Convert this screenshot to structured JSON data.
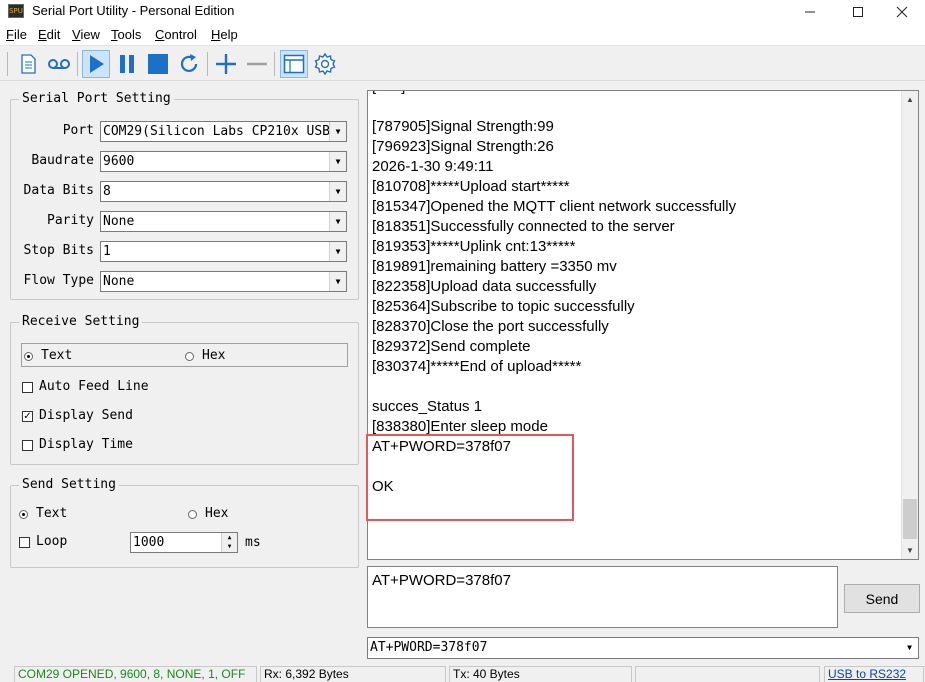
{
  "window": {
    "title": "Serial Port Utility - Personal Edition",
    "icon_label": "SPU",
    "minimize_icon": "minimize-icon",
    "maximize_icon": "maximize-icon",
    "close_icon": "close-icon"
  },
  "menu": [
    {
      "key": "F",
      "rest": "ile"
    },
    {
      "key": "E",
      "rest": "dit"
    },
    {
      "key": "V",
      "rest": "iew"
    },
    {
      "key": "T",
      "rest": "ools"
    },
    {
      "key": "C",
      "rest": "ontrol"
    },
    {
      "key": "H",
      "rest": "elp"
    }
  ],
  "toolbar": {
    "icons": [
      "new-file-icon",
      "record-icon",
      "play-icon",
      "pause-icon",
      "stop-icon",
      "refresh-icon",
      "add-icon",
      "remove-icon",
      "window-icon",
      "gear-icon"
    ],
    "accent": "#1e6fc8"
  },
  "serial_port_setting": {
    "title": "Serial Port Setting",
    "port_label": "Port",
    "port_value": "COM29(Silicon Labs CP210x USB",
    "baudrate_label": "Baudrate",
    "baudrate_value": "9600",
    "data_bits_label": "Data Bits",
    "data_bits_value": "8",
    "parity_label": "Parity",
    "parity_value": "None",
    "stop_bits_label": "Stop Bits",
    "stop_bits_value": "1",
    "flow_type_label": "Flow Type",
    "flow_type_value": "None"
  },
  "receive_setting": {
    "title": "Receive Setting",
    "text_label": "Text",
    "hex_label": "Hex",
    "mode": "Text",
    "auto_feed_line_label": "Auto Feed Line",
    "auto_feed_line_checked": false,
    "display_send_label": "Display Send",
    "display_send_checked": true,
    "display_time_label": "Display Time",
    "display_time_checked": false
  },
  "send_setting": {
    "title": "Send Setting",
    "text_label": "Text",
    "hex_label": "Hex",
    "mode": "Text",
    "loop_label": "Loop",
    "loop_checked": false,
    "interval_value": "1000",
    "interval_unit": "ms"
  },
  "receive_lines": [
    "[-----]----------",
    "",
    "[787905]Signal Strength:99",
    "[796923]Signal Strength:26",
    "2026-1-30 9:49:11",
    "[810708]*****Upload start*****",
    "[815347]Opened the MQTT client network successfully",
    "[818351]Successfully connected to the server",
    "[819353]*****Uplink cnt:13*****",
    "[819891]remaining battery =3350 mv",
    "[822358]Upload data successfully",
    "[825364]Subscribe to topic successfully",
    "[828370]Close the port successfully",
    "[829372]Send complete",
    "[830374]*****End of upload*****",
    "",
    "succes_Status 1",
    "[838380]Enter sleep mode",
    "AT+PWORD=378f07",
    "",
    "OK"
  ],
  "highlight_color": "#e05a5a",
  "send_input_value": "AT+PWORD=378f07",
  "send_button_label": "Send",
  "history_value": "AT+PWORD=378f07",
  "status": {
    "port_status": "COM29 OPENED, 9600, 8, NONE, 1, OFF",
    "port_status_color": "#1a8a1a",
    "rx": "Rx: 6,392 Bytes",
    "tx": "Tx: 40 Bytes",
    "link": "USB to RS232",
    "link_color": "#0645ad"
  }
}
